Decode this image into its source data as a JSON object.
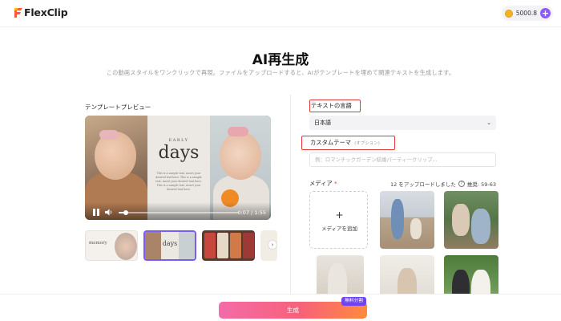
{
  "header": {
    "logo_text": "FlexClip",
    "credits": "5000.8",
    "plus_label": "+"
  },
  "main": {
    "title": "AI再生成",
    "subtitle": "この動画スタイルをワンクリックで再現。ファイルをアップロードすると、AIがテンプレートを埋めて関連テキストを生成します。"
  },
  "preview": {
    "label": "テンプレートプレビュー",
    "slide_word_small": "EARLY",
    "slide_word_big": "days",
    "slide_body": "This is a sample text, insert your desired text here. This is a sample text, insert your desired text here. This is a sample text, insert your desired text here.",
    "time": "0:07 / 1:55",
    "progress": 0.06,
    "thumb1_text": "memory",
    "thumb2_text": "days",
    "arrow": "›"
  },
  "form": {
    "language_label": "テキストの言語",
    "language_value": "日本語",
    "chevron": "⌄",
    "theme_label": "カスタムテーマ",
    "theme_optional": "(オプション)",
    "theme_placeholder": "例：ロマンチックガーデン結婚パーティークリップ...",
    "media_label": "メディア",
    "media_required": "*",
    "media_upload_info": "12 をアップロードしました",
    "media_q": "?",
    "media_recommend": "推奨: 59-63",
    "add_media_plus": "+",
    "add_media_label": "メディアを追加"
  },
  "footer": {
    "generate_label": "生成",
    "free_badge": "無料分割"
  },
  "colors": {
    "accent": "#7b5cf1",
    "highlight_border": "#e03a3a"
  }
}
